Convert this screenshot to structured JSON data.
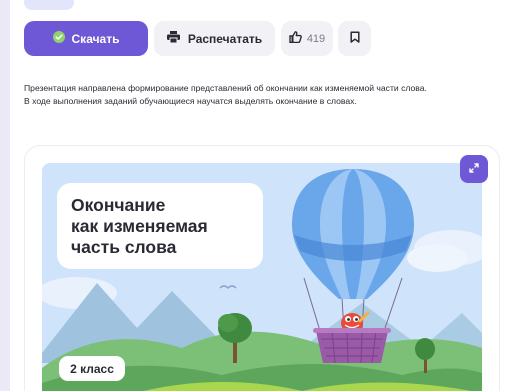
{
  "actions": {
    "download_label": "Скачать",
    "print_label": "Распечатать",
    "like_count": "419"
  },
  "description": {
    "line1": "Презентация направлена формирование представлений об окончании как изменяемой части слова.",
    "line2": "В ходе выполнения заданий обучающиеся научатся выделять окончание в словах."
  },
  "slide": {
    "title_lines": [
      "Окончание",
      "как изменяемая",
      "часть слова"
    ],
    "grade": "2 класс"
  },
  "icons": {
    "download": "check-circle-icon",
    "print": "printer-icon",
    "like": "thumbs-up-icon",
    "save": "bookmark-icon",
    "expand": "expand-icon"
  },
  "colors": {
    "accent": "#6e58d6",
    "button_bg": "#f1f1f6",
    "page_bg": "#ece9f7",
    "slide_sky": "#cfe3fb"
  }
}
